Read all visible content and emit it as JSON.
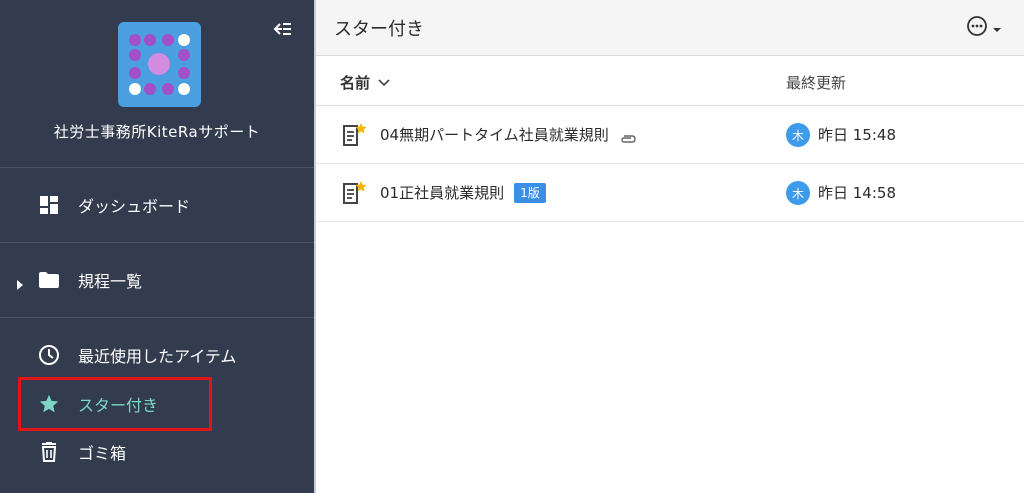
{
  "sidebar": {
    "org_name": "社労士事務所KiteRaサポート",
    "nav": {
      "dashboard": "ダッシュボード",
      "regulations": "規程一覧",
      "recent": "最近使用したアイテム",
      "starred": "スター付き",
      "trash": "ゴミ箱"
    },
    "icons": {
      "collapse": "collapse-sidebar-icon",
      "dashboard": "dashboard-icon",
      "folder": "folder-icon",
      "clock": "clock-icon",
      "star": "star-icon",
      "trash": "trash-icon"
    }
  },
  "header": {
    "title": "スター付き"
  },
  "table": {
    "columns": {
      "name": "名前",
      "updated": "最終更新"
    },
    "rows": [
      {
        "name": "04無期パートタイム社員就業規則",
        "attachment": true,
        "badge": "",
        "avatar": "木",
        "updated": "昨日 15:48"
      },
      {
        "name": "01正社員就業規則",
        "attachment": false,
        "badge": "1版",
        "avatar": "木",
        "updated": "昨日 14:58"
      }
    ]
  },
  "colors": {
    "sidebar_bg": "#323c4e",
    "active": "#7ed7c6",
    "accent": "#3d8fe6",
    "highlight": "#e01515",
    "logo_bg": "#4b9fe0",
    "logo_dot_purple": "#a34fc7",
    "logo_center": "#d28ce0"
  }
}
